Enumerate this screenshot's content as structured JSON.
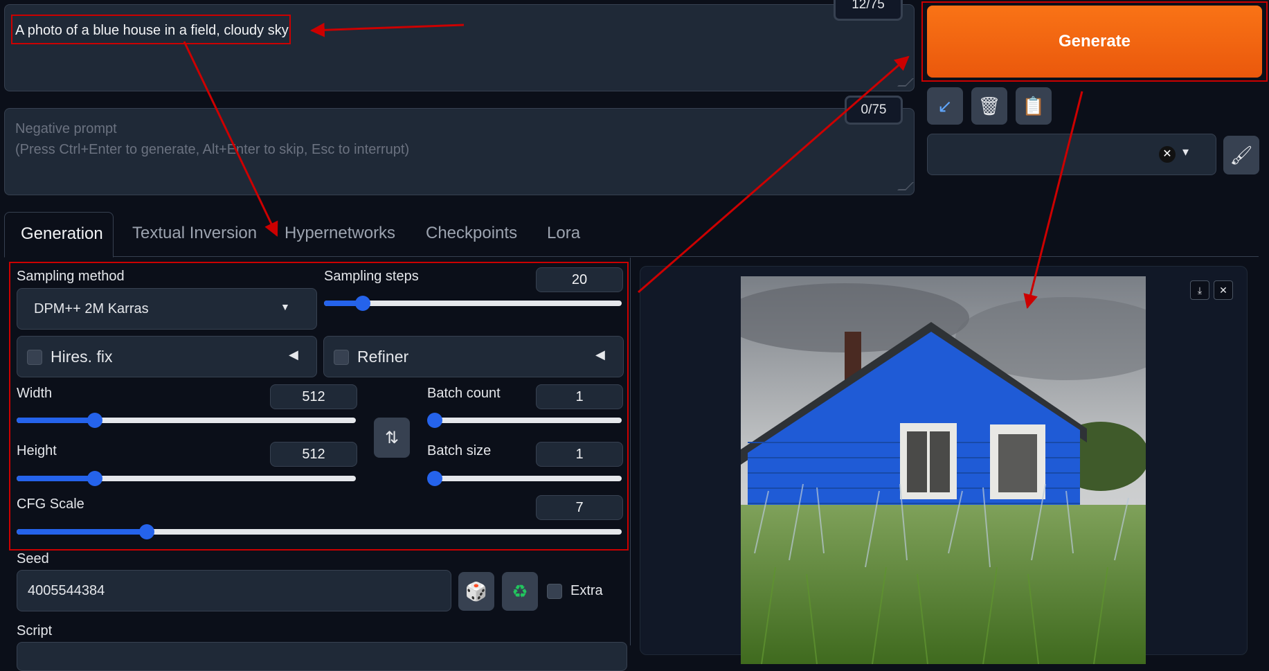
{
  "prompt": {
    "value": "A photo of a blue house in a field, cloudy sky",
    "token_count": "12/75"
  },
  "negative_prompt": {
    "placeholder_line1": "Negative prompt",
    "placeholder_line2": "(Press Ctrl+Enter to generate, Alt+Enter to skip, Esc to interrupt)",
    "token_count": "0/75"
  },
  "generate_button": {
    "label": "Generate"
  },
  "tools": [
    {
      "icon": "arrow-down-left-icon",
      "glyph": "↙"
    },
    {
      "icon": "trash-icon",
      "glyph": "🗑"
    },
    {
      "icon": "clipboard-icon",
      "glyph": "📋"
    }
  ],
  "style_dropdown": {
    "clear_glyph": "✕",
    "chevron_glyph": "▾"
  },
  "brush_glyph": "🖌",
  "tabs": [
    "Generation",
    "Textual Inversion",
    "Hypernetworks",
    "Checkpoints",
    "Lora"
  ],
  "sampling_method": {
    "label": "Sampling method",
    "value": "DPM++ 2M Karras"
  },
  "sampling_steps": {
    "label": "Sampling steps",
    "value": "20",
    "fraction": 0.13
  },
  "hires_fix": {
    "label": "Hires. fix"
  },
  "refiner": {
    "label": "Refiner"
  },
  "width": {
    "label": "Width",
    "value": "512",
    "fraction": 0.23
  },
  "height": {
    "label": "Height",
    "value": "512",
    "fraction": 0.23
  },
  "batch_count": {
    "label": "Batch count",
    "value": "1",
    "fraction": 0.0
  },
  "batch_size": {
    "label": "Batch size",
    "value": "1",
    "fraction": 0.0
  },
  "cfg_scale": {
    "label": "CFG Scale",
    "value": "7",
    "fraction": 0.215
  },
  "swap_glyph": "⇅",
  "seed": {
    "label": "Seed",
    "value": "4005544384",
    "extra_label": "Extra"
  },
  "dice_glyph": "🎲",
  "recycle_glyph": "♻",
  "script": {
    "label": "Script"
  },
  "colors": {
    "accent": "#2563eb",
    "generate": "#f97316",
    "annotation": "#cc0000"
  }
}
